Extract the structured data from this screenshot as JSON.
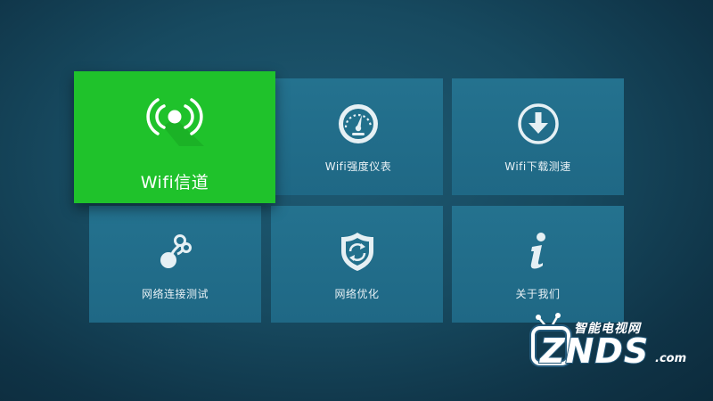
{
  "tiles": [
    {
      "id": "wifi-channel",
      "label": "Wifi信道",
      "icon": "wifi-signal-icon",
      "focused": true
    },
    {
      "id": "wifi-strength",
      "label": "Wifi强度仪表",
      "icon": "gauge-icon",
      "focused": false
    },
    {
      "id": "wifi-download",
      "label": "Wifi下载测速",
      "icon": "download-icon",
      "focused": false
    },
    {
      "id": "network-test",
      "label": "网络连接测试",
      "icon": "network-connection-icon",
      "focused": false
    },
    {
      "id": "network-optimize",
      "label": "网络优化",
      "icon": "shield-refresh-icon",
      "focused": false
    },
    {
      "id": "about",
      "label": "关于我们",
      "icon": "info-icon",
      "focused": false
    }
  ],
  "watermark": {
    "top_text": "智能电视网",
    "brand": "ZNDS",
    "domain": ".com"
  },
  "colors": {
    "tile": "#216e8a",
    "focused_tile": "#1fc22b",
    "background": "#174a60"
  }
}
